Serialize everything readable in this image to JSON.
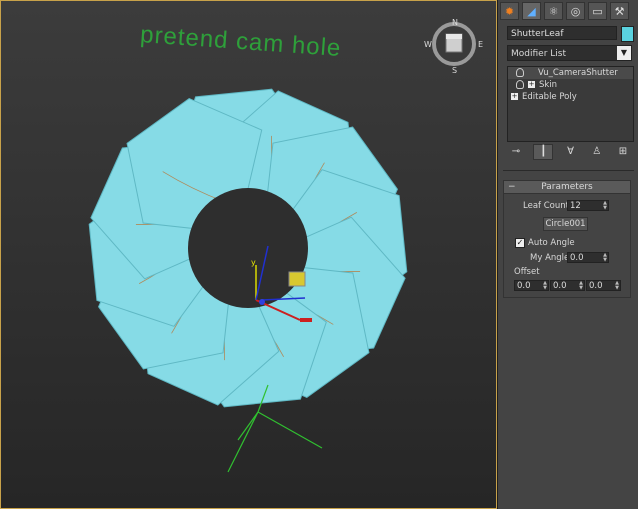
{
  "viewport": {
    "scene_text": "pretend cam hole",
    "compass": {
      "n": "N",
      "s": "S",
      "e": "E",
      "w": "W"
    },
    "gizmo_label": "y"
  },
  "panel": {
    "tabs": [
      {
        "icon": "create-icon",
        "glyph": "✹"
      },
      {
        "icon": "modify-icon",
        "glyph": "◢"
      },
      {
        "icon": "hierarchy-icon",
        "glyph": "⚛"
      },
      {
        "icon": "motion-icon",
        "glyph": "◎"
      },
      {
        "icon": "display-icon",
        "glyph": "▭"
      },
      {
        "icon": "utilities-icon",
        "glyph": "⚒"
      }
    ],
    "object_name": "ShutterLeaf",
    "object_color": "#5ad2df",
    "modifier_list": "Modifier List",
    "stack": [
      {
        "label": "Vu_CameraShutter",
        "type": "bulb"
      },
      {
        "label": "Skin",
        "type": "bulb-plus"
      },
      {
        "label": "Editable Poly",
        "type": "plus"
      }
    ],
    "tools": [
      "pin-stack-icon",
      "show-end-result-icon",
      "make-unique-icon",
      "remove-modifier-icon",
      "configure-sets-icon"
    ],
    "parameters": {
      "title": "Parameters",
      "leaf_count_label": "Leaf Count",
      "leaf_count": "12",
      "circle_button": "Circle001",
      "auto_angle_label": "Auto Angle",
      "auto_angle_checked": true,
      "my_angle_label": "My Angle",
      "my_angle": "0.0",
      "offset_label": "Offset",
      "offset_x": "0.0",
      "offset_y": "0.0",
      "offset_z": "0.0"
    }
  }
}
